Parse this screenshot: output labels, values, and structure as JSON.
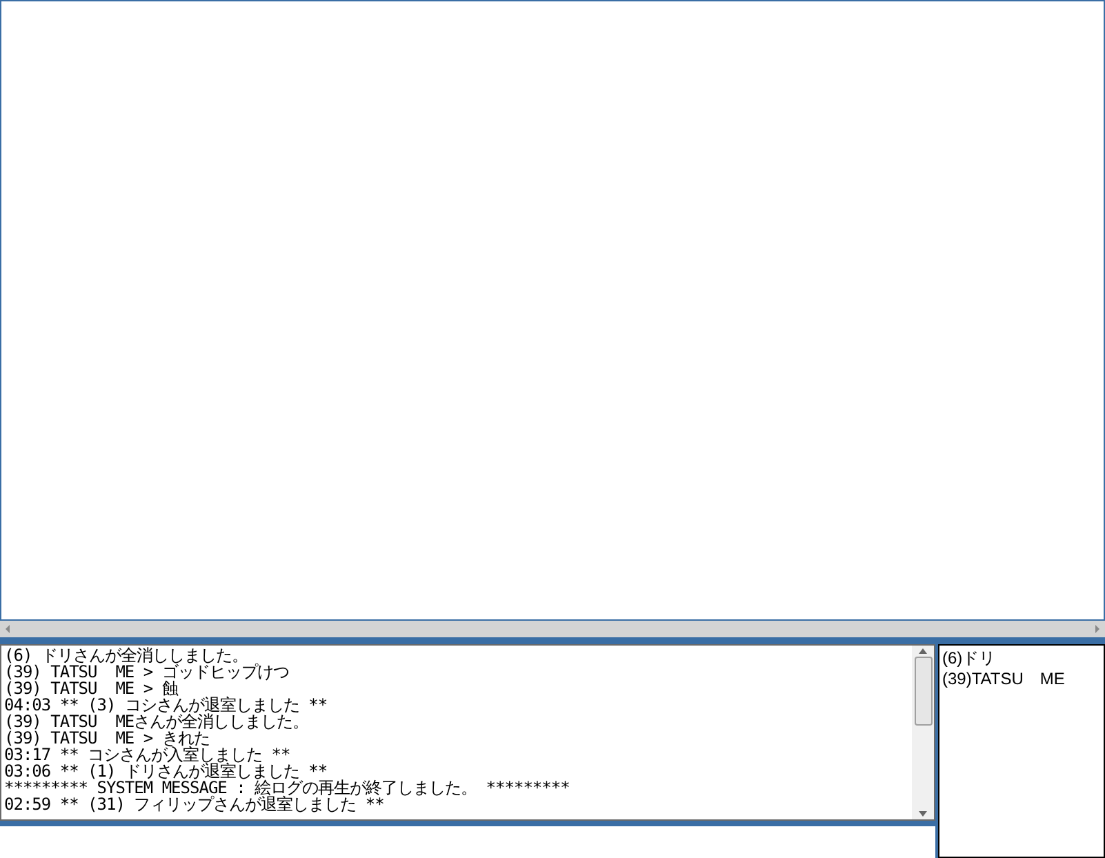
{
  "log": {
    "lines": [
      "(6) ドリさんが全消ししました。",
      "(39) TATSU  ME > ゴッドヒップけつ",
      "(39) TATSU  ME > 蝕",
      "04:03 ** (3) コシさんが退室しました **",
      "(39) TATSU  MEさんが全消ししました。",
      "(39) TATSU  ME > きれた",
      "03:17 ** コシさんが入室しました **",
      "03:06 ** (1) ドリさんが退室しました **",
      "********* SYSTEM MESSAGE : 絵ログの再生が終了しました。 *********",
      "02:59 ** (31) フィリップさんが退室しました **"
    ]
  },
  "users": [
    "(6)ドリ",
    "(39)TATSU　ME"
  ]
}
